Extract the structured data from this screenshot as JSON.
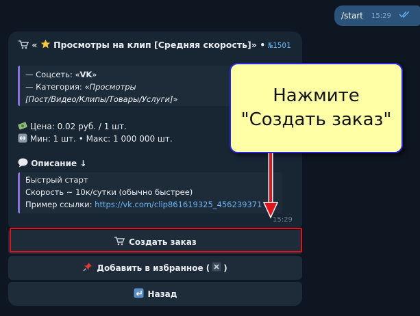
{
  "outgoing": {
    "text": "/start",
    "time": "15:29"
  },
  "message": {
    "title_prefix": "«",
    "title": "Просмотры на клип [Средняя скорость]»",
    "title_sep": " • ",
    "number": "№1501",
    "social_prefix": "— Соцсеть: «",
    "social_value": "VK",
    "social_suffix": "»",
    "category_prefix": "— Категория: «",
    "category_value_1": "Просмотры",
    "category_value_2": "[Пост/Видео/Клипы/Товары/Услуги]",
    "category_suffix": "»",
    "price": "Цена: 0.02 руб. / 1 шт.",
    "minmax": "Мин: 1 шт. • Макс: 1 000 000 шт.",
    "description_label": "Описание ↓",
    "desc_line1": "Быстрый старт",
    "desc_line2": "Скорость ~ 10к/сутки (обычно быстрее)",
    "desc_line3_label": "Пример ссылки: ",
    "desc_link": "https://vk.com/clip861619325_456239371",
    "time": "15:29"
  },
  "buttons": {
    "create": "Создать заказ",
    "favorite_prefix": "Добавить в избранное (",
    "favorite_suffix": ")",
    "back": "Назад"
  },
  "callout": {
    "line1": "Нажмите",
    "line2": "\"Создать заказ\""
  },
  "colors": {
    "background": "#0e1621",
    "bubble": "#182533",
    "outgoing": "#2b5278",
    "accent": "#6ab2f2",
    "highlight": "#e0141c",
    "callout": "#ffffa6"
  }
}
